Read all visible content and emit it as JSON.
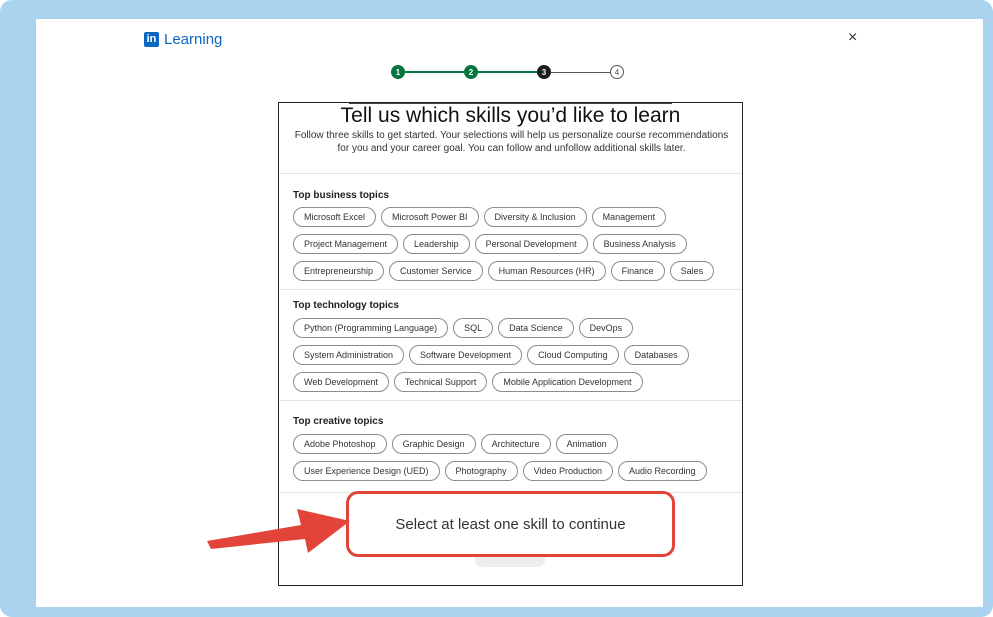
{
  "brand": {
    "logo_mark": "in",
    "name": "Learning"
  },
  "close_icon": "×",
  "stepper": [
    {
      "label": "1",
      "state": "done"
    },
    {
      "label": "2",
      "state": "done"
    },
    {
      "label": "3",
      "state": "active"
    },
    {
      "label": "4",
      "state": "todo"
    }
  ],
  "modal": {
    "title": "Tell us which skills you’d like to learn",
    "subtitle": "Follow three skills to get started. Your selections will help us personalize course recommendations for you and your career goal. You can follow and unfollow additional skills later.",
    "sections": [
      {
        "title": "Top business topics",
        "chips": [
          "Microsoft Excel",
          "Microsoft Power BI",
          "Diversity & Inclusion",
          "Management",
          "Project Management",
          "Leadership",
          "Personal Development",
          "Business Analysis",
          "Entrepreneurship",
          "Customer Service",
          "Human Resources (HR)",
          "Finance",
          "Sales"
        ]
      },
      {
        "title": "Top technology topics",
        "chips": [
          "Python (Programming Language)",
          "SQL",
          "Data Science",
          "DevOps",
          "System Administration",
          "Software Development",
          "Cloud Computing",
          "Databases",
          "Web Development",
          "Technical Support",
          "Mobile Application Development"
        ]
      },
      {
        "title": "Top creative topics",
        "chips": [
          "Adobe Photoshop",
          "Graphic Design",
          "Architecture",
          "Animation",
          "User Experience Design (UED)",
          "Photography",
          "Video Production",
          "Audio Recording"
        ]
      }
    ]
  },
  "callout": {
    "text": "Select at least one skill to continue"
  },
  "colors": {
    "accent": "#0a66c2",
    "step_done": "#057642",
    "callout_border": "#e2443a",
    "frame": "#a9d3ee"
  }
}
